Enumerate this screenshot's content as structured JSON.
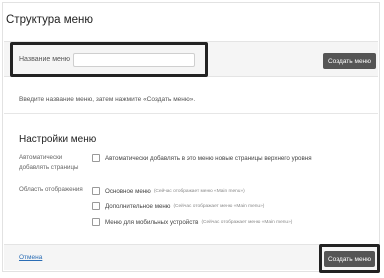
{
  "header": {
    "title": "Структура меню"
  },
  "menu_name": {
    "label": "Название меню",
    "value": "",
    "create_button": "Создать меню"
  },
  "instruction": "Введите название меню, затем нажмите «Создать меню».",
  "settings": {
    "title": "Настройки меню",
    "auto_add": {
      "label": "Автоматически добавлять страницы",
      "option": "Автоматически добавлять в это меню новые страницы верхнего уровня",
      "checked": false
    },
    "display_location": {
      "label": "Область отображения",
      "options": [
        {
          "name": "Основное меню",
          "hint": "(Сейчас отображает меню «Main menu»)",
          "checked": false
        },
        {
          "name": "Дополнительное меню",
          "hint": "(Сейчас отображает меню «Main menu»)",
          "checked": false
        },
        {
          "name": "Меню для мобильных устройств",
          "hint": "(Сейчас отображает меню «Main menu»)",
          "checked": false
        }
      ]
    }
  },
  "footer": {
    "cancel": "Отмена",
    "create_button": "Создать меню"
  }
}
